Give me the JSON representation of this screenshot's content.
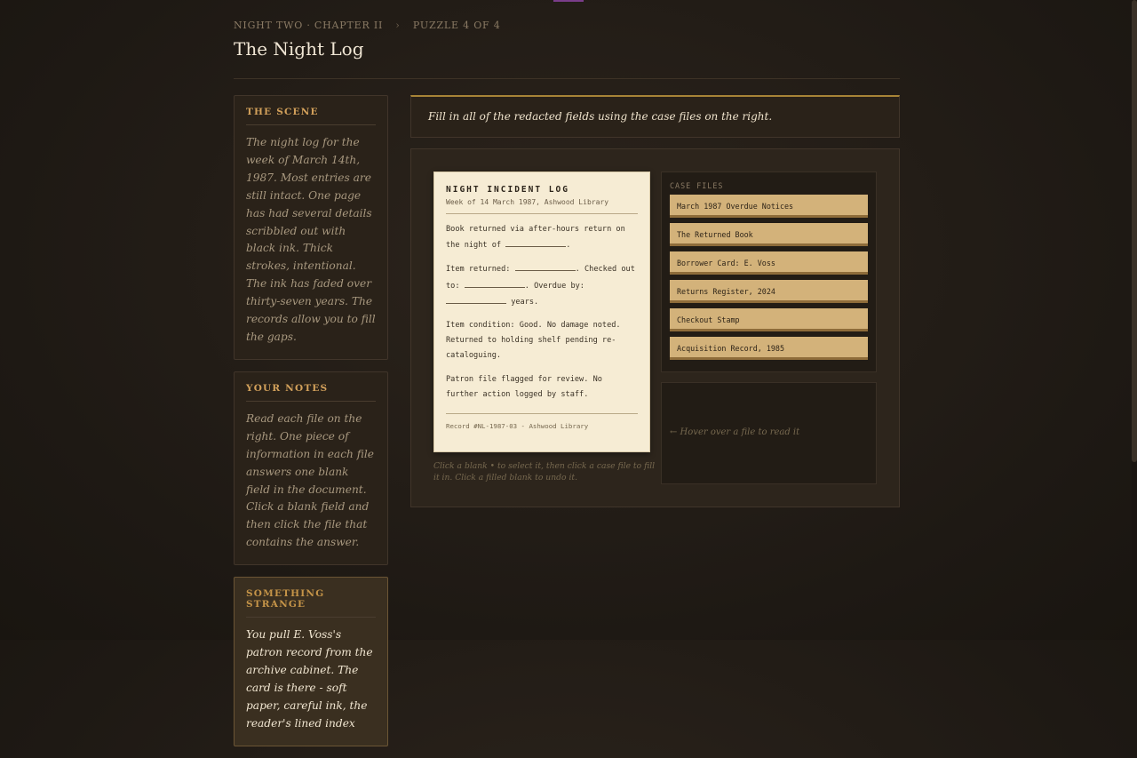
{
  "header": {
    "breadcrumb_chapter": "NIGHT TWO · CHAPTER II",
    "breadcrumb_separator": "›",
    "breadcrumb_puzzle": "PUZZLE 4 OF 4",
    "title": "The Night Log"
  },
  "sidebar": {
    "scene": {
      "heading": "THE SCENE",
      "text": "The night log for the week of March 14th, 1987. Most entries are still intact. One page has had several details scribbled out with black ink. Thick strokes, intentional. The ink has faded over thirty-seven years. The records allow you to fill the gaps."
    },
    "notes": {
      "heading": "YOUR NOTES",
      "text": "Read each file on the right. One piece of information in each file answers one blank field in the document. Click a blank field and then click the file that contains the answer."
    },
    "strange": {
      "heading": "SOMETHING STRANGE",
      "text": "You pull E. Voss's patron record from the archive cabinet. The card is there - soft paper, careful ink, the reader's lined index"
    }
  },
  "instruction": "Fill in all of the redacted fields using the case files on the right.",
  "document": {
    "title": "NIGHT INCIDENT LOG",
    "subtitle": "Week of 14 March 1987, Ashwood Library",
    "p1_a": "Book returned via after-hours return on the night of",
    "p1_b": ".",
    "p2_a": "Item returned:",
    "p2_b": ". Checked out to:",
    "p2_c": ". Overdue by:",
    "p2_d": "years.",
    "p3": "Item condition: Good. No damage noted. Returned to holding shelf pending re-cataloguing.",
    "p4": "Patron file flagged for review. No further action logged by staff.",
    "footer": "Record #NL-1987-03 - Ashwood Library"
  },
  "hint": "Click a blank • to select it, then click a case file to fill it in. Click a filled blank to undo it.",
  "case_files": {
    "label": "CASE FILES",
    "files": [
      "March 1987 Overdue Notices",
      "The Returned Book",
      "Borrower Card: E. Voss",
      "Returns Register, 2024",
      "Checkout Stamp",
      "Acquisition Record, 1985"
    ]
  },
  "reader": {
    "hint": "← Hover over a file to read it"
  },
  "colors": {
    "background": "#1e1914",
    "accent_gold": "#d3a15b",
    "paper": "#f6ecd4",
    "file_tab": "#d3b27a"
  }
}
